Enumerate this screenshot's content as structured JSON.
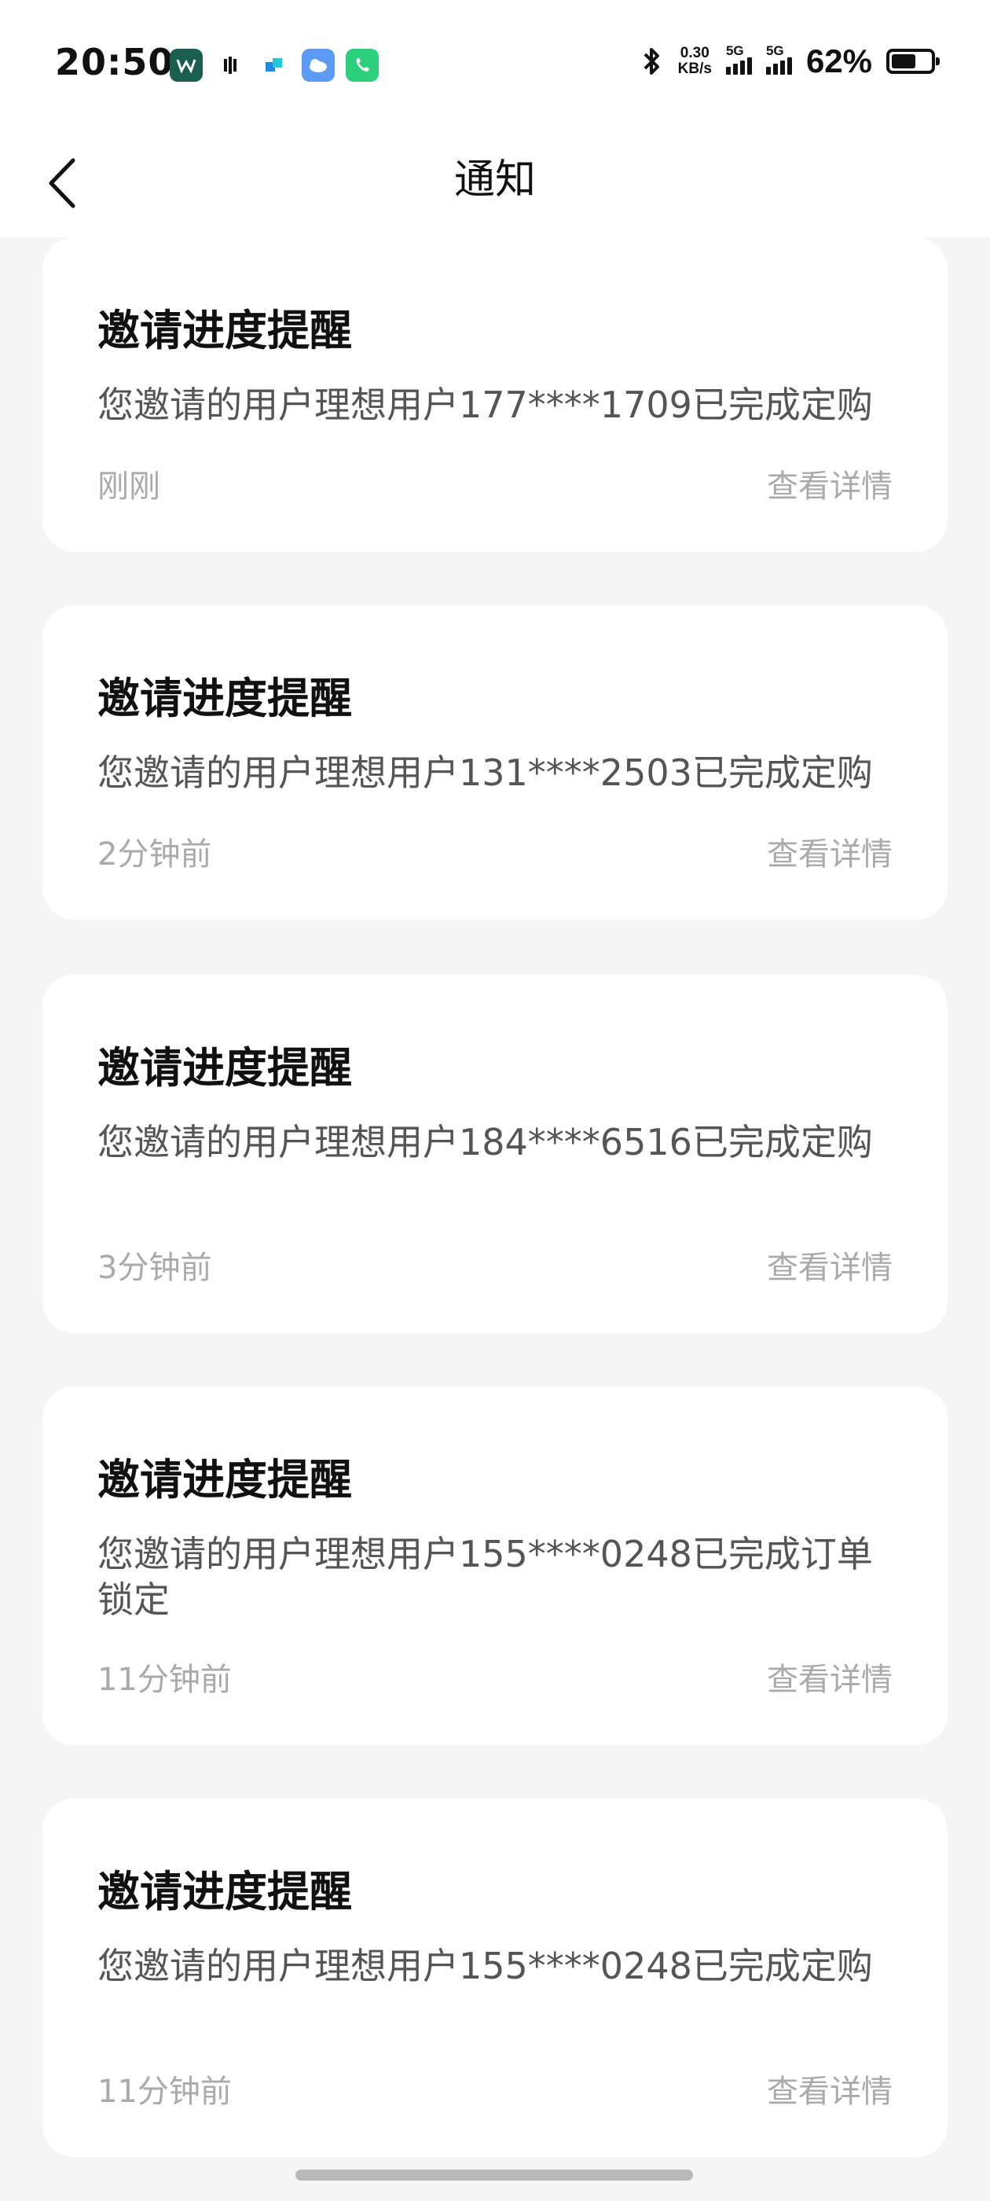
{
  "status_bar": {
    "time": "20:50",
    "net_speed_value": "0.30",
    "net_speed_unit": "KB/s",
    "signal1_label": "5G",
    "signal2_label": "5G",
    "battery_percent": "62%",
    "battery_level": 0.62,
    "app_icons": [
      {
        "name": "wps-app-icon",
        "color": "#1a5e4f"
      },
      {
        "name": "lixiang-app-icon",
        "color": "#ffffff"
      },
      {
        "name": "translate-app-icon",
        "color": "#ffffff"
      },
      {
        "name": "weather-app-icon",
        "color": "#5b9bf5"
      },
      {
        "name": "phone-app-icon",
        "color": "#2ccf7c"
      }
    ]
  },
  "header": {
    "title": "通知"
  },
  "notifications": [
    {
      "title": "邀请进度提醒",
      "body": "您邀请的用户理想用户177****1709已完成定购",
      "time": "刚刚",
      "detail": "查看详情"
    },
    {
      "title": "邀请进度提醒",
      "body": "您邀请的用户理想用户131****2503已完成定购",
      "time": "2分钟前",
      "detail": "查看详情"
    },
    {
      "title": "邀请进度提醒",
      "body": "您邀请的用户理想用户184****6516已完成定购",
      "time": "3分钟前",
      "detail": "查看详情"
    },
    {
      "title": "邀请进度提醒",
      "body": "您邀请的用户理想用户155****0248已完成订单锁定",
      "time": "11分钟前",
      "detail": "查看详情"
    },
    {
      "title": "邀请进度提醒",
      "body": "您邀请的用户理想用户155****0248已完成定购",
      "time": "11分钟前",
      "detail": "查看详情"
    }
  ]
}
